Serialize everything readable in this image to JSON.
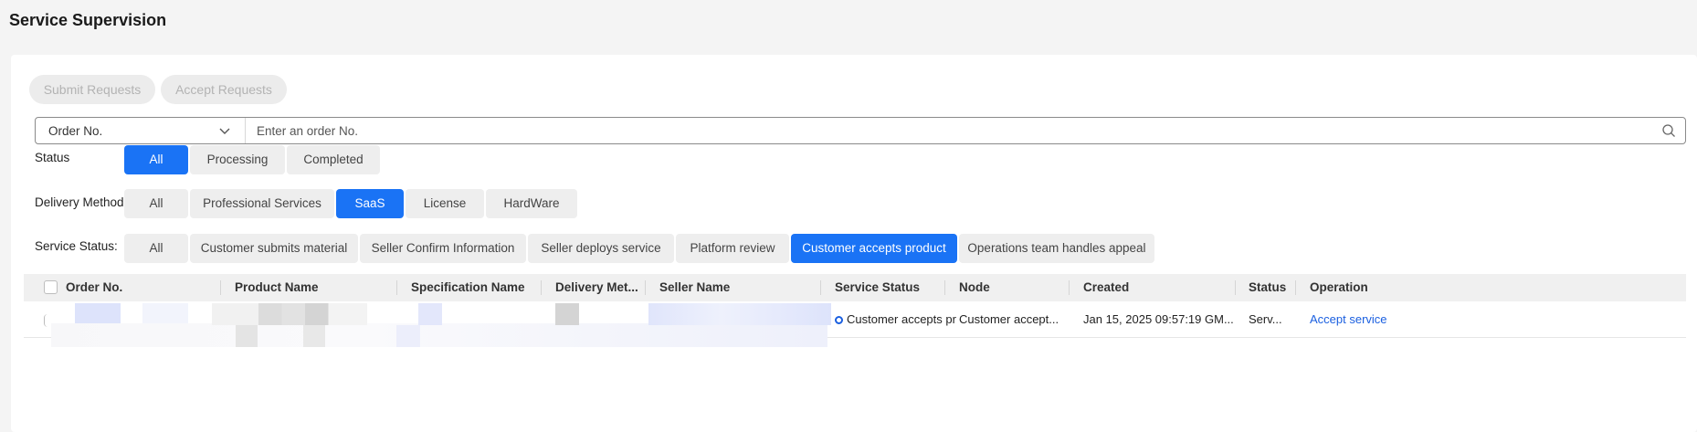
{
  "page": {
    "title": "Service Supervision"
  },
  "toolbar": {
    "submit_label": "Submit Requests",
    "accept_label": "Accept Requests"
  },
  "search": {
    "field_selected": "Order No.",
    "placeholder": "Enter an order No."
  },
  "filters": {
    "status": {
      "label": "Status",
      "options": [
        "All",
        "Processing",
        "Completed"
      ],
      "active": "All"
    },
    "delivery": {
      "label": "Delivery Method",
      "options": [
        "All",
        "Professional Services",
        "SaaS",
        "License",
        "HardWare"
      ],
      "active": "SaaS"
    },
    "service_status": {
      "label": "Service Status:",
      "options": [
        "All",
        "Customer submits material",
        "Seller Confirm Information",
        "Seller deploys service",
        "Platform review",
        "Customer accepts product",
        "Operations team handles appeal"
      ],
      "active": "Customer accepts product"
    }
  },
  "table": {
    "columns": [
      "Order No.",
      "Product Name",
      "Specification Name",
      "Delivery Met...",
      "Seller Name",
      "Service Status",
      "Node",
      "Created",
      "Status",
      "Operation"
    ],
    "rows": [
      {
        "service_status": "Customer accepts pr",
        "node": "Customer accept...",
        "created": "Jan 15, 2025 09:57:19 GM...",
        "status": "Serv...",
        "operation": "Accept service"
      }
    ]
  },
  "colors": {
    "accent": "#1a73f5",
    "link": "#1a5fe0"
  },
  "icons": {
    "select": "chevron-down-icon",
    "search": "search-icon",
    "status": "status-circle-icon"
  }
}
